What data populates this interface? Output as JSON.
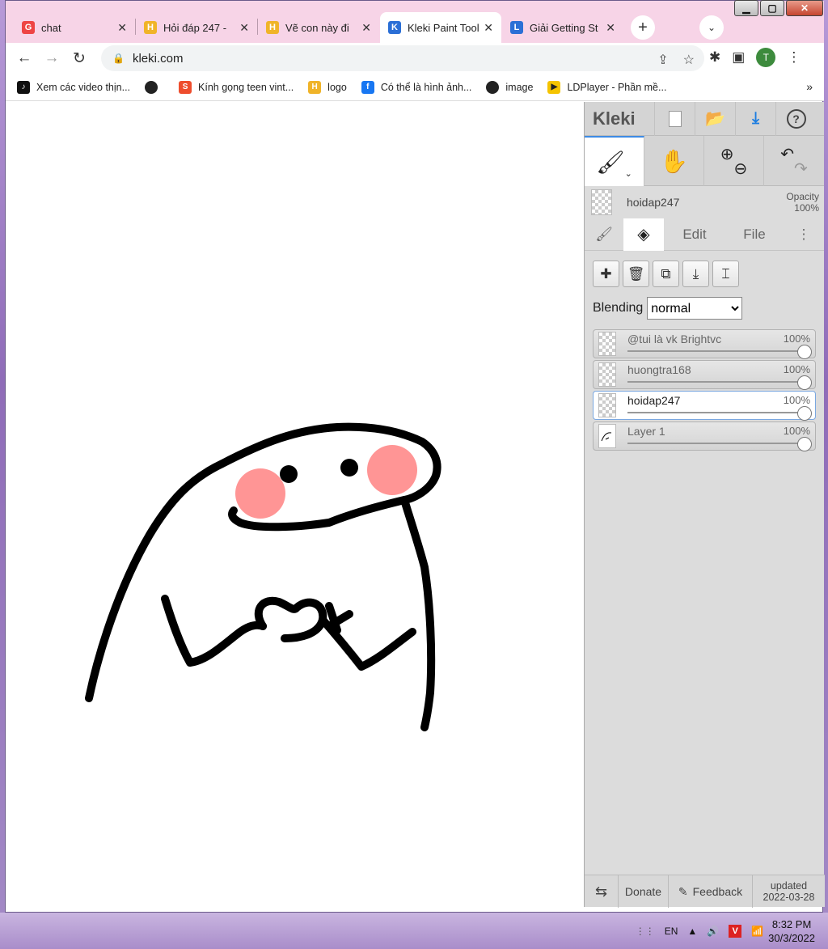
{
  "window": {
    "minimize": "▁",
    "maximize": "▢",
    "close": "✕"
  },
  "tabs": [
    {
      "title": "chat",
      "color": "#e44",
      "glyph": "G"
    },
    {
      "title": "Hỏi đáp 247 -",
      "color": "#f0b429",
      "glyph": "H"
    },
    {
      "title": "Vẽ con này đi",
      "color": "#f0b429",
      "glyph": "H"
    },
    {
      "title": "Kleki Paint Tool",
      "color": "#2b6fd6",
      "glyph": "K"
    },
    {
      "title": "Giải Getting St",
      "color": "#2b6fd6",
      "glyph": "L"
    }
  ],
  "tab_close": "✕",
  "newtab": "+",
  "tabsearch": "⌄",
  "toolbar": {
    "back": "←",
    "forward": "→",
    "reload": "↻",
    "url": "kleki.com"
  },
  "bookmarks": [
    {
      "label": "Xem các video thịn...",
      "color": "#111",
      "glyph": "♪"
    },
    {
      "label": "",
      "color": "#222",
      "glyph": "●"
    },
    {
      "label": "Kính gọng teen vint...",
      "color": "#ee4d2d",
      "glyph": "S"
    },
    {
      "label": "logo",
      "color": "#f0b429",
      "glyph": "H"
    },
    {
      "label": "Có thể là hình ảnh...",
      "color": "#1877f2",
      "glyph": "f"
    },
    {
      "label": "image",
      "color": "#222",
      "glyph": "●"
    },
    {
      "label": "LDPlayer - Phần mề...",
      "color": "#f5c400",
      "glyph": "▶"
    }
  ],
  "bookmarks_more": "»",
  "kleki": {
    "logo": "Kleki",
    "current_layer": "hoidap247",
    "opacity_label": "Opacity",
    "opacity_value": "100%",
    "tab_edit": "Edit",
    "tab_file": "File",
    "blending_label": "Blending",
    "blending_value": "normal",
    "layers": [
      {
        "name": "@tui là vk Brightvc",
        "opacity": "100%",
        "selected": false
      },
      {
        "name": "huongtra168",
        "opacity": "100%",
        "selected": false
      },
      {
        "name": "hoidap247",
        "opacity": "100%",
        "selected": true
      },
      {
        "name": "Layer 1",
        "opacity": "100%",
        "selected": false
      }
    ],
    "footer": {
      "donate": "Donate",
      "feedback": "Feedback",
      "updated_label": "updated",
      "updated_date": "2022-03-28"
    }
  },
  "tray": {
    "lang": "EN",
    "time": "8:32 PM",
    "date": "30/3/2022"
  }
}
